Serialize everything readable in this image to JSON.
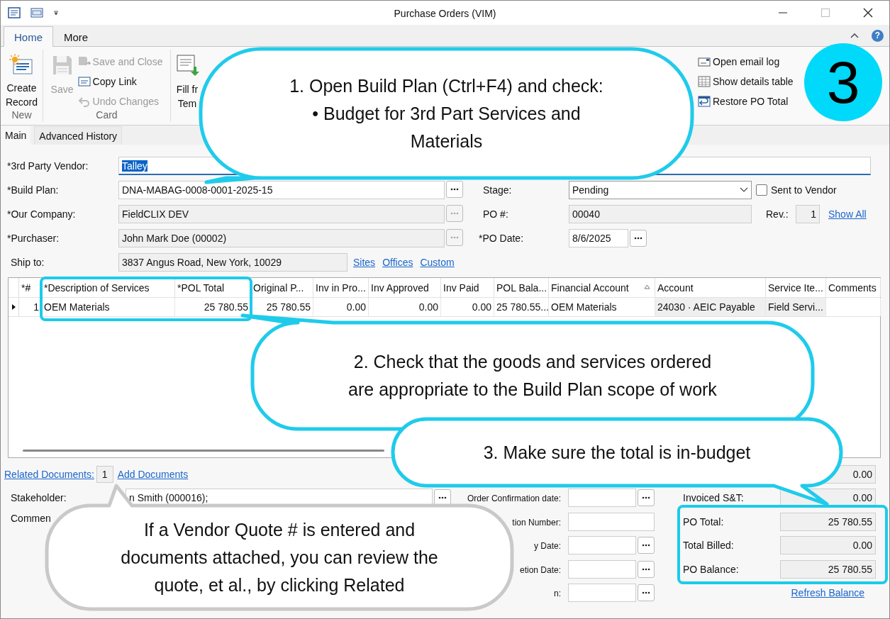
{
  "window": {
    "title": "Purchase Orders (VIM)"
  },
  "ribbon": {
    "tabs": [
      {
        "label": "Home",
        "selected": true
      },
      {
        "label": "More",
        "selected": false
      }
    ],
    "help": "?",
    "new_group": {
      "name": "New",
      "create": {
        "lines": [
          "Create",
          "Record"
        ],
        "disabled": false
      }
    },
    "card_group": {
      "name": "Card",
      "save": {
        "label": "Save",
        "disabled": true
      },
      "save_close": {
        "label": "Save and Close",
        "disabled": true
      },
      "copy_link": {
        "label": "Copy Link",
        "disabled": false
      },
      "undo": {
        "label": "Undo Changes",
        "disabled": true
      }
    },
    "fill": {
      "lines": [
        "Fill fr",
        "Tem"
      ]
    },
    "actions": [
      {
        "label": "Open email log"
      },
      {
        "label": "Show details table"
      },
      {
        "label": "Restore PO Total"
      }
    ]
  },
  "card_tabs": [
    {
      "label": "Main",
      "selected": true
    },
    {
      "label": "Advanced History",
      "selected": false
    }
  ],
  "form": {
    "vendor": {
      "label": "*3rd Party Vendor:",
      "value": "Talley",
      "text_selected": true
    },
    "build_plan": {
      "label": "*Build Plan:",
      "value": "DNA-MABAG-0008-0001-2025-15",
      "disabled": false
    },
    "our_company": {
      "label": "*Our Company:",
      "value": "FieldCLIX DEV",
      "disabled": true
    },
    "purchaser": {
      "label": "*Purchaser:",
      "value": "John Mark Doe (00002)",
      "disabled": true
    },
    "ship_to": {
      "label": "Ship to:",
      "value": "3837 Angus Road, New York, 10029",
      "disabled": true
    },
    "ship_links": [
      "Sites",
      "Offices",
      "Custom"
    ],
    "stage": {
      "label": "Stage:",
      "value": "Pending"
    },
    "sent_to_vendor": {
      "label": "Sent to Vendor",
      "checked": false
    },
    "po_number": {
      "label": "PO #:",
      "value": "00040",
      "disabled": true
    },
    "revision": {
      "label": "Rev.:",
      "value": "1"
    },
    "show_all": "Show All",
    "po_date": {
      "label": "*PO Date:",
      "value": "8/6/2025"
    }
  },
  "grid": {
    "columns": [
      {
        "label": "*#",
        "numeric": true,
        "readonly": false,
        "sorted": false
      },
      {
        "label": "*Description of Services",
        "numeric": false,
        "readonly": false,
        "sorted": false
      },
      {
        "label": "*POL Total",
        "numeric": true,
        "readonly": false,
        "sorted": false
      },
      {
        "label": "Original P...",
        "numeric": true,
        "readonly": false,
        "sorted": false
      },
      {
        "label": "Inv in Pro...",
        "numeric": true,
        "readonly": false,
        "sorted": false
      },
      {
        "label": "Inv Approved",
        "numeric": true,
        "readonly": false,
        "sorted": false
      },
      {
        "label": "Inv Paid",
        "numeric": true,
        "readonly": false,
        "sorted": false
      },
      {
        "label": "POL Bala...",
        "numeric": false,
        "readonly": false,
        "sorted": false
      },
      {
        "label": "Financial Account",
        "numeric": false,
        "readonly": false,
        "sorted": true
      },
      {
        "label": "Account",
        "numeric": false,
        "readonly": true,
        "sorted": false
      },
      {
        "label": "Service Ite...",
        "numeric": false,
        "readonly": true,
        "sorted": false
      },
      {
        "label": "Comments",
        "sorted": false
      }
    ],
    "rows": [
      {
        "current": true,
        "cells": [
          "1",
          "OEM Materials",
          "25 780.55",
          "25 780.55",
          "0.00",
          "0.00",
          "0.00",
          "25 780.55...",
          "OEM Materials",
          "24030 · AEIC Payable",
          "Field Servi..."
        ]
      }
    ]
  },
  "footer": {
    "related_documents": {
      "label": "Related Documents:",
      "count": "1"
    },
    "add_documents": "Add Documents",
    "stakeholder": {
      "label": "Stakeholder:",
      "value": "n Smith (000016);"
    },
    "comments_label": "Commen",
    "middle_fields": [
      {
        "label": "Order Confirmation date:",
        "kind": "date"
      },
      {
        "label": "tion Number:",
        "kind": "text"
      },
      {
        "label": "y Date:",
        "kind": "date"
      },
      {
        "label": "etion Date:",
        "kind": "date"
      },
      {
        "label": "n:",
        "kind": "date"
      }
    ],
    "totals": [
      {
        "value": "0.00"
      },
      {
        "label": "Invoiced S&T:",
        "value": "0.00"
      },
      {
        "label": "PO Total:",
        "value": "25 780.55"
      },
      {
        "label": "Total Billed:",
        "value": "0.00"
      },
      {
        "label": "PO Balance:",
        "value": "25 780.55"
      }
    ],
    "refresh_balance": "Refresh Balance"
  },
  "annotations": {
    "step_badge": "3",
    "callouts": [
      {
        "kind": "cyan",
        "lines": [
          "1. Open Build Plan (Ctrl+F4) and check:",
          "• Budget for 3rd Part Services and",
          "Materials"
        ]
      },
      {
        "kind": "cyan",
        "lines": [
          "2. Check that the goods and services ordered",
          "are appropriate to the Build Plan scope of work"
        ]
      },
      {
        "kind": "cyan",
        "lines": [
          "3. Make sure the total is in-budget"
        ]
      },
      {
        "kind": "gray",
        "lines": [
          "If a Vendor Quote # is entered and",
          "documents attached, you can review the",
          "quote, et al., by clicking Related"
        ]
      }
    ]
  }
}
